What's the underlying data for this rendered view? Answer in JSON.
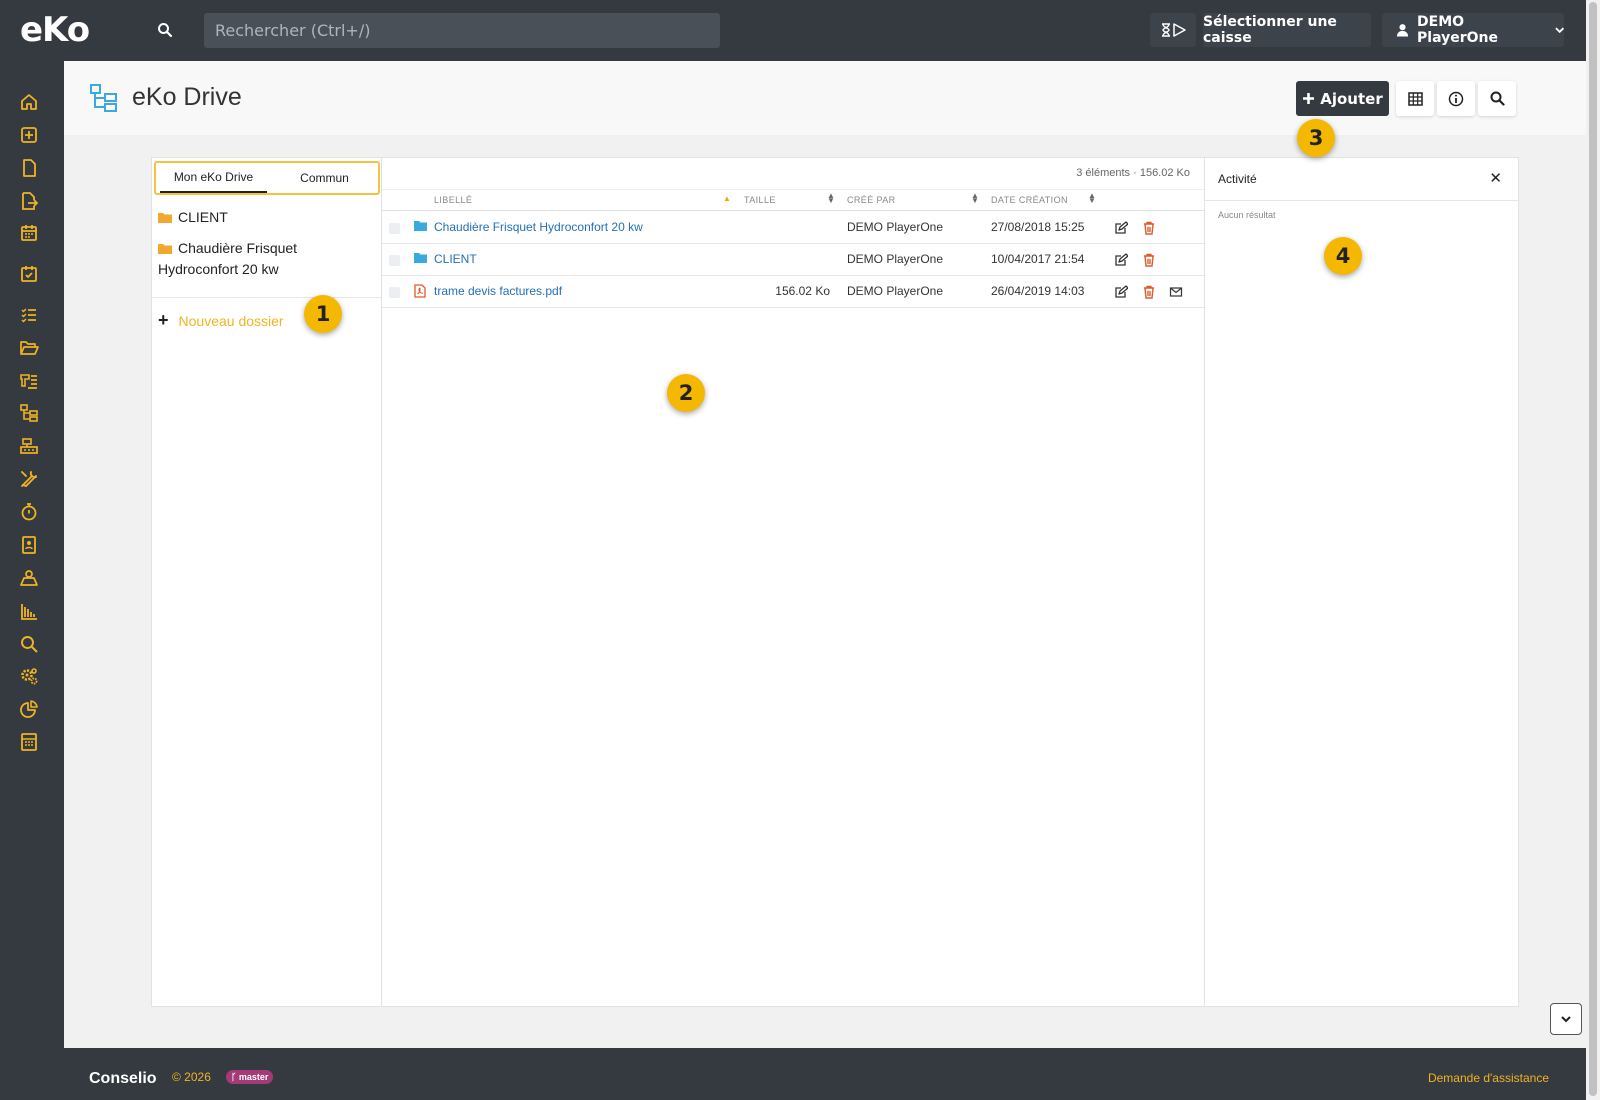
{
  "topbar": {
    "logo": "eKo",
    "search_placeholder": "Rechercher (Ctrl+/)",
    "select_register": "Sélectionner une caisse",
    "user": "DEMO PlayerOne"
  },
  "page": {
    "title": "eKo Drive",
    "add_label": "Ajouter"
  },
  "tree": {
    "tabs": [
      "Mon eKo Drive",
      "Commun"
    ],
    "folders": [
      "CLIENT",
      "Chaudière Frisquet",
      "Hydroconfort 20 kw"
    ],
    "new_folder": "Nouveau dossier"
  },
  "files": {
    "summary": "3 éléments · 156.02 Ko",
    "columns": {
      "name": "LIBELLÉ",
      "size": "TAILLE",
      "created_by": "CRÉÉ PAR",
      "created_date": "DATE CRÉATION"
    },
    "rows": [
      {
        "name": "Chaudière Frisquet Hydroconfort 20 kw",
        "size": "",
        "by": "DEMO PlayerOne",
        "date": "27/08/2018 15:25",
        "type": "folder"
      },
      {
        "name": "CLIENT",
        "size": "",
        "by": "DEMO PlayerOne",
        "date": "10/04/2017 21:54",
        "type": "folder"
      },
      {
        "name": "trame devis factures.pdf",
        "size": "156.02 Ko",
        "by": "DEMO PlayerOne",
        "date": "26/04/2019 14:03",
        "type": "pdf"
      }
    ]
  },
  "activity": {
    "title": "Activité",
    "empty": "Aucun résultat"
  },
  "badges": [
    "1",
    "2",
    "3",
    "4"
  ],
  "footer": {
    "brand": "Conselio",
    "copyright": "© 2026",
    "branch": "master",
    "assist": "Demande d'assistance"
  },
  "colors": {
    "accent": "#f0b323",
    "dark": "#343a40",
    "link": "#2270b5",
    "folder": "#f0a830",
    "folder_blue": "#3ba8e0",
    "delete": "#e05a2a"
  }
}
